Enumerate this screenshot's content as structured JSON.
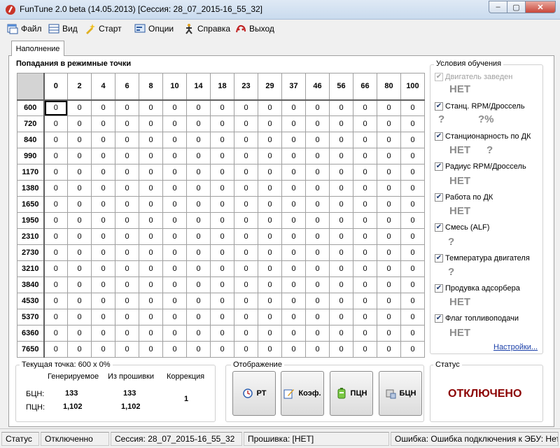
{
  "window": {
    "title": "FunTune 2.0 beta (14.05.2013) [Сессия: 28_07_2015-16_55_32]",
    "buttons": {
      "minimize": "–",
      "maximize": "▢",
      "close": "✕"
    }
  },
  "menu": [
    {
      "label": "Файл",
      "icon": "file-icon"
    },
    {
      "label": "Вид",
      "icon": "view-icon"
    },
    {
      "label": "Старт",
      "icon": "start-icon"
    },
    {
      "label": "Опции",
      "icon": "options-icon"
    },
    {
      "label": "Справка",
      "icon": "help-icon"
    },
    {
      "label": "Выход",
      "icon": "exit-icon"
    }
  ],
  "tab": {
    "label": "Наполнение"
  },
  "grid": {
    "title": "Попадания в режимные точки",
    "columns": [
      "0",
      "2",
      "4",
      "6",
      "8",
      "10",
      "14",
      "18",
      "23",
      "29",
      "37",
      "46",
      "56",
      "66",
      "80",
      "100"
    ],
    "rows": [
      "600",
      "720",
      "840",
      "990",
      "1170",
      "1380",
      "1650",
      "1950",
      "2310",
      "2730",
      "3210",
      "3840",
      "4530",
      "5370",
      "6360",
      "7650"
    ],
    "cell_value": "0"
  },
  "conditions": {
    "title": "Условия обучения",
    "items": [
      {
        "label": "Двигатель заведен",
        "checked": true,
        "disabled": true,
        "values": [
          "НЕТ"
        ]
      },
      {
        "label": "Станц. RPM/Дроссель",
        "checked": true,
        "disabled": false,
        "values": [
          "?",
          "?%"
        ]
      },
      {
        "label": "Станционарность по ДК",
        "checked": true,
        "disabled": false,
        "values": [
          "НЕТ",
          "?"
        ]
      },
      {
        "label": "Радиус RPM/Дроссель",
        "checked": true,
        "disabled": false,
        "values": [
          "НЕТ"
        ]
      },
      {
        "label": "Работа по ДК",
        "checked": true,
        "disabled": false,
        "values": [
          "НЕТ"
        ]
      },
      {
        "label": "Смесь (ALF)",
        "checked": true,
        "disabled": false,
        "values": [
          "?"
        ]
      },
      {
        "label": "Температура двигателя",
        "checked": true,
        "disabled": false,
        "values": [
          "?"
        ]
      },
      {
        "label": "Продувка адсорбера",
        "checked": true,
        "disabled": false,
        "values": [
          "НЕТ"
        ]
      },
      {
        "label": "Флаг топливоподачи",
        "checked": true,
        "disabled": false,
        "values": [
          "НЕТ"
        ]
      }
    ],
    "settings_link": "Настройки..."
  },
  "current_point": {
    "title": "Текущая точка: 600 x 0%",
    "col_generated": "Генерируемое",
    "col_firmware": "Из прошивки",
    "col_correction": "Коррекция",
    "rows": [
      {
        "label": "БЦН:",
        "generated": "133",
        "firmware": "133"
      },
      {
        "label": "ПЦН:",
        "generated": "1,102",
        "firmware": "1,102"
      }
    ],
    "correction": "1"
  },
  "display": {
    "title": "Отображение",
    "buttons": [
      {
        "label": "РТ",
        "icon": "clock-icon"
      },
      {
        "label": "Коэф.",
        "icon": "edit-icon"
      },
      {
        "label": "ПЦН",
        "icon": "battery-icon"
      },
      {
        "label": "БЦН",
        "icon": "chip-icon"
      }
    ]
  },
  "status": {
    "title": "Статус",
    "value": "ОТКЛЮЧЕНО"
  },
  "statusbar": {
    "status_label": "Статус",
    "status_value": "Отключенно",
    "session": "Сессия:  28_07_2015-16_55_32",
    "firmware": "Прошивка:  [НЕТ]",
    "error": "Ошибка: Ошибка подключения к ЭБУ: Нет"
  }
}
